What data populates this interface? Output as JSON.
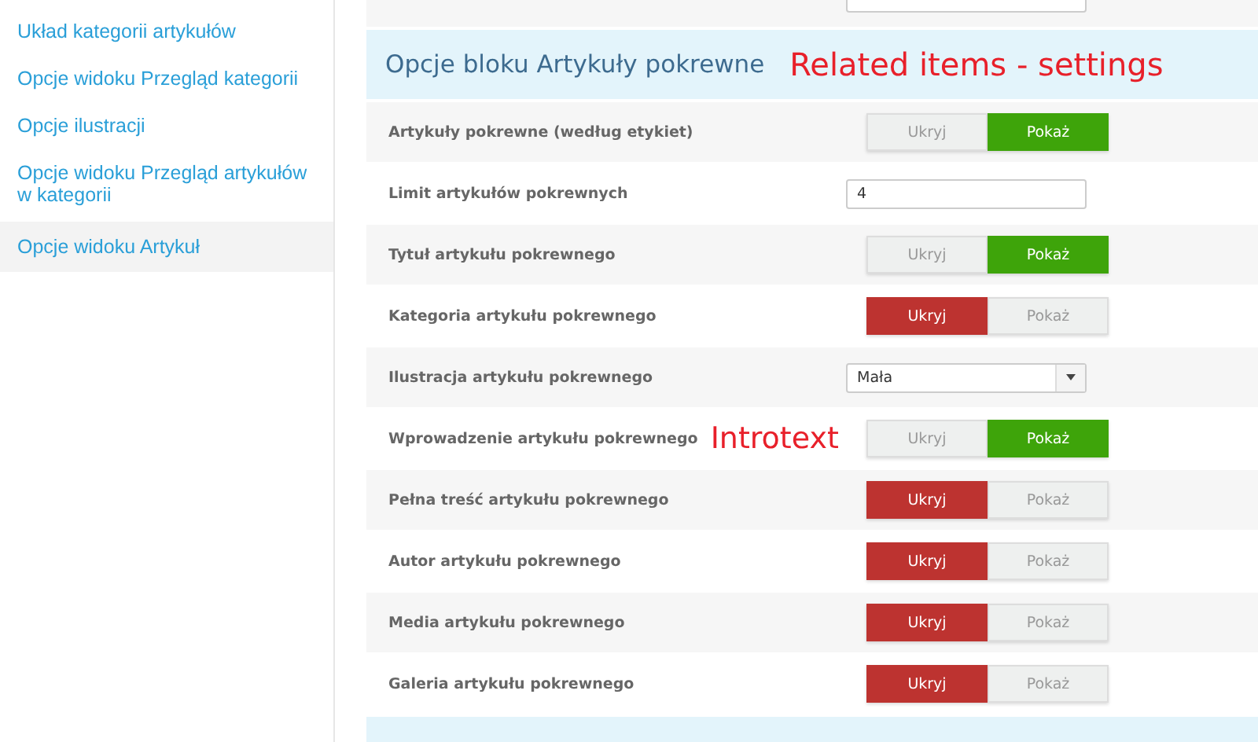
{
  "sidebar": {
    "items": [
      {
        "label": "Układ kategorii artykułów",
        "selected": false
      },
      {
        "label": "Opcje widoku Przegląd kategorii",
        "selected": false
      },
      {
        "label": "Opcje ilustracji",
        "selected": false
      },
      {
        "label": "Opcje widoku Przegląd artykułów w kategorii",
        "selected": false
      },
      {
        "label": "Opcje widoku Artykuł",
        "selected": true
      }
    ]
  },
  "top_row": {
    "kind": "input"
  },
  "section": {
    "title": "Opcje bloku Artykuły pokrewne",
    "annotation": "Related items - settings"
  },
  "rows": [
    {
      "label": "Artykuły pokrewne (według etykiet)",
      "kind": "toggle",
      "options": [
        {
          "label": "Ukryj",
          "kind": "hide",
          "selected": false
        },
        {
          "label": "Pokaż",
          "kind": "show",
          "selected": true
        }
      ]
    },
    {
      "label": "Limit artykułów pokrewnych",
      "kind": "input",
      "value": "4"
    },
    {
      "label": "Tytuł artykułu pokrewnego",
      "kind": "toggle",
      "options": [
        {
          "label": "Ukryj",
          "kind": "hide",
          "selected": false
        },
        {
          "label": "Pokaż",
          "kind": "show",
          "selected": true
        }
      ]
    },
    {
      "label": "Kategoria artykułu pokrewnego",
      "kind": "toggle",
      "options": [
        {
          "label": "Ukryj",
          "kind": "hide",
          "selected": true
        },
        {
          "label": "Pokaż",
          "kind": "show",
          "selected": false
        }
      ]
    },
    {
      "label": "Ilustracja artykułu pokrewnego",
      "kind": "select",
      "value": "Mała"
    },
    {
      "label": "Wprowadzenie artykułu pokrewnego",
      "kind": "toggle",
      "annotation": "Introtext",
      "options": [
        {
          "label": "Ukryj",
          "kind": "hide",
          "selected": false
        },
        {
          "label": "Pokaż",
          "kind": "show",
          "selected": true
        }
      ]
    },
    {
      "label": "Pełna treść artykułu pokrewnego",
      "kind": "toggle",
      "options": [
        {
          "label": "Ukryj",
          "kind": "hide",
          "selected": true
        },
        {
          "label": "Pokaż",
          "kind": "show",
          "selected": false
        }
      ]
    },
    {
      "label": "Autor artykułu pokrewnego",
      "kind": "toggle",
      "options": [
        {
          "label": "Ukryj",
          "kind": "hide",
          "selected": true
        },
        {
          "label": "Pokaż",
          "kind": "show",
          "selected": false
        }
      ]
    },
    {
      "label": "Media artykułu pokrewnego",
      "kind": "toggle",
      "options": [
        {
          "label": "Ukryj",
          "kind": "hide",
          "selected": true
        },
        {
          "label": "Pokaż",
          "kind": "show",
          "selected": false
        }
      ]
    },
    {
      "label": "Galeria artykułu pokrewnego",
      "kind": "toggle",
      "options": [
        {
          "label": "Ukryj",
          "kind": "hide",
          "selected": true
        },
        {
          "label": "Pokaż",
          "kind": "show",
          "selected": false
        }
      ]
    }
  ]
}
